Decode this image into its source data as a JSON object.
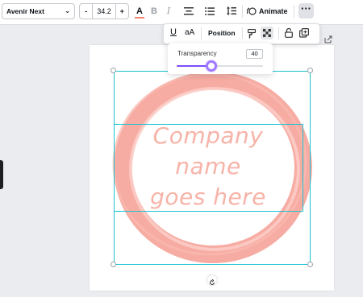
{
  "toolbar": {
    "font_family": "Avenir Next",
    "font_size": "34.2",
    "decrease_label": "-",
    "increase_label": "+",
    "text_color_glyph": "A",
    "text_color_swatch": "#f4836f",
    "bold_glyph": "B",
    "italic_glyph": "I",
    "animate_label": "Animate",
    "more_glyph": "···"
  },
  "format_popup": {
    "underline_glyph": "U",
    "case_glyph": "aA",
    "position_label": "Position"
  },
  "transparency": {
    "label": "Transparency",
    "value": "40",
    "level_percent": 40,
    "accent": "#7c4dff"
  },
  "canvas": {
    "text_lines": [
      "Company",
      "name",
      "goes here"
    ],
    "circle_color": "#f7a89e",
    "text_color": "#f7b3a8",
    "selection_color": "#1cc3d1"
  }
}
